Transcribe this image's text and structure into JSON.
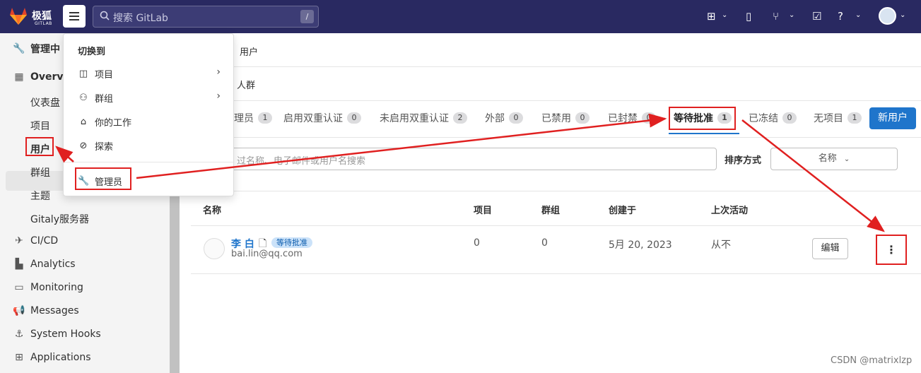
{
  "navbar": {
    "logo_text": "极狐",
    "logo_sub": "GITLAB",
    "search_placeholder": "搜索 GitLab",
    "search_shortcut": "/"
  },
  "sidebar": {
    "header": "管理中",
    "overview_label": "Overvie",
    "sub_items": [
      "仪表盘",
      "项目",
      "用户",
      "群组",
      "主题",
      "Gitaly服务器"
    ],
    "items": [
      "CI/CD",
      "Analytics",
      "Monitoring",
      "Messages",
      "System Hooks",
      "Applications"
    ]
  },
  "dropdown": {
    "header": "切换到",
    "items": [
      "项目",
      "群组",
      "你的工作",
      "探索"
    ],
    "admin_label": "管理员"
  },
  "main": {
    "breadcrumb_top": "用户",
    "breadcrumb_second": "人群",
    "tabs": [
      {
        "label": "理员",
        "count": "1"
      },
      {
        "label": "启用双重认证",
        "count": "0"
      },
      {
        "label": "未启用双重认证",
        "count": "2"
      },
      {
        "label": "外部",
        "count": "0"
      },
      {
        "label": "已禁用",
        "count": "0"
      },
      {
        "label": "已封禁",
        "count": "0"
      },
      {
        "label": "等待批准",
        "count": "1"
      },
      {
        "label": "已冻结",
        "count": "0"
      },
      {
        "label": "无项目",
        "count": "1"
      }
    ],
    "new_user_button": "新用户",
    "filter_placeholder": "过名称、电子邮件或用户名搜索",
    "sort_label": "排序方式",
    "sort_value": "名称",
    "table_headers": [
      "名称",
      "项目",
      "群组",
      "创建于",
      "上次活动"
    ],
    "row": {
      "name": "李 白",
      "status": "等待批准",
      "email": "bai.lin@qq.com",
      "projects": "0",
      "groups": "0",
      "created": "5月 20, 2023",
      "last_activity": "从不",
      "edit_button": "编辑"
    }
  },
  "watermark": "CSDN @matrixlzp",
  "colors": {
    "navbar": "#292961",
    "accent": "#1f75cb",
    "annotation": "#e02020"
  }
}
